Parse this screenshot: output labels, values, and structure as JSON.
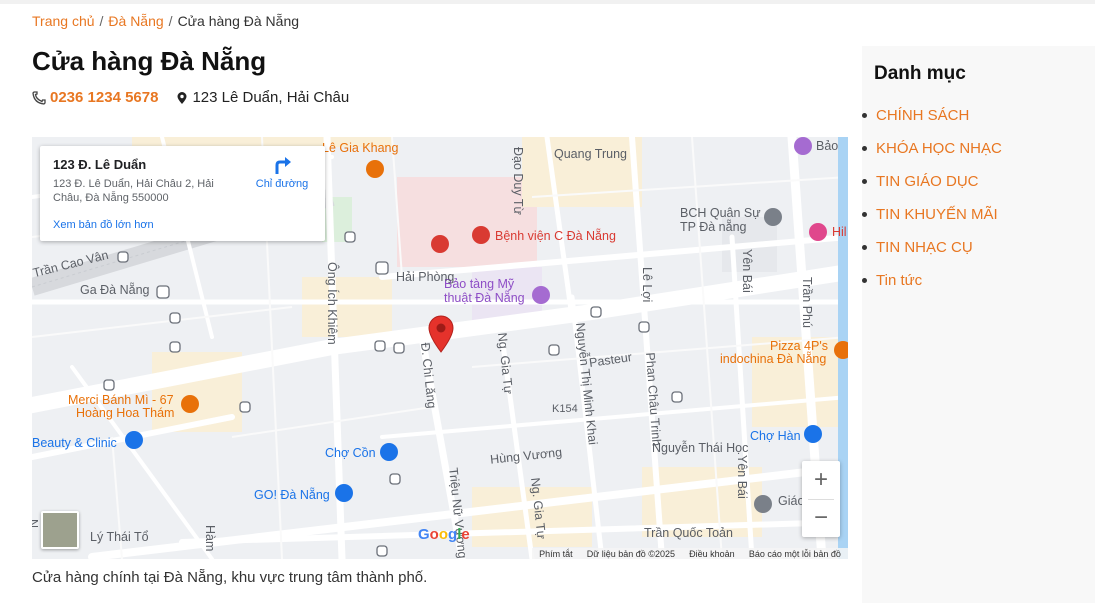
{
  "breadcrumb": {
    "home": "Trang chủ",
    "city": "Đà Nẵng",
    "current": "Cửa hàng Đà Nẵng",
    "separator": "/"
  },
  "page": {
    "title": "Cửa hàng Đà Nẵng",
    "phone": "0236 1234 5678",
    "address": "123 Lê Duẩn, Hải Châu",
    "caption": "Cửa hàng chính tại Đà Nẵng, khu vực trung tâm thành phố."
  },
  "map": {
    "card": {
      "title": "123 Đ. Lê Duẩn",
      "address": "123 Đ. Lê Duẩn, Hải Châu 2, Hải Châu, Đà Nẵng 550000",
      "view_larger": "Xem bản đồ lớn hơn",
      "directions": "Chỉ đường"
    },
    "labels": {
      "quang_trung": "Quang Trung",
      "le_gia_khang": "Lê Gia Khang",
      "dao_duy_tu": "Đạo Duy Từ",
      "benh_vien": "Bệnh viện C Đà Nẵng",
      "bch_quan_su_1": "BCH Quân Sự",
      "bch_quan_su_2": "TP Đà nẵng",
      "bao_tang_1": "Bảo tàng Mỹ",
      "bao_tang_2": "thuật Đà Nẵng",
      "hai_phong": "Hải Phòng",
      "tran_cao_van": "Trần Cao Vân",
      "ga_da_nang": "Ga Đà Nẵng",
      "ong_ich_khiem": "Ông Ích Khiêm",
      "le_loi": "Lê Lợi",
      "yen_bai_top": "Yên Bái",
      "tran_phu": "Trần Phú",
      "pizza_1": "Pizza 4P's",
      "pizza_2": "indochina Đà Nẵng",
      "pasteur": "Pasteur",
      "merci_1": "Merci Bánh Mì - 67",
      "merci_2": "Hoàng Hoa Thám",
      "chi_lang": "Đ. Chi Lăng",
      "ng_gia_tu": "Ng. Gia Tự",
      "nguyen_thi_minh_khai": "Nguyễn Thị Minh Khai",
      "phan_chau_trinh": "Phan Châu Trinh",
      "k154": "K154",
      "beauty_clinic": "Beauty & Clinic",
      "cho_con": "Chợ Cồn",
      "hung_vuong": "Hùng Vương",
      "nguyen_thai_hoc": "Nguyễn Thái Học",
      "cho_han": "Chợ Hàn",
      "go_da_nang": "GO! Đà Nẵng",
      "yen_bai_bottom": "Yên Bái",
      "ly_thai_to": "Lý Thái Tổ",
      "trieu_nu_vuong": "Triệu Nữ Vương",
      "tran_quoc_toan": "Trần Quốc Toản",
      "bao": "Bảo",
      "hil": "Hil",
      "giao": "Giáo",
      "ham": "Hàm",
      "n": "N"
    },
    "logo": "Google",
    "footer": {
      "shortcuts": "Phím tắt",
      "data": "Dữ liệu bản đồ ©2025",
      "terms": "Điều khoản",
      "report": "Báo cáo một lỗi bản đồ"
    },
    "zoom_in": "+",
    "zoom_out": "−"
  },
  "sidebar": {
    "title": "Danh mục",
    "items": [
      {
        "label": "CHÍNH SÁCH"
      },
      {
        "label": "KHÓA HỌC NHẠC"
      },
      {
        "label": "TIN GIÁO DỤC"
      },
      {
        "label": "TIN KHUYẾN MÃI"
      },
      {
        "label": "TIN NHẠC CỤ"
      },
      {
        "label": "Tin tức"
      }
    ]
  },
  "colors": {
    "accent": "#e87722",
    "map_link": "#1a73e8",
    "pin": "#d93a32"
  },
  "icons": {
    "phone": "phone-icon",
    "pin": "location-pin-icon",
    "directions": "directions-icon",
    "map_marker": "map-marker-icon"
  }
}
